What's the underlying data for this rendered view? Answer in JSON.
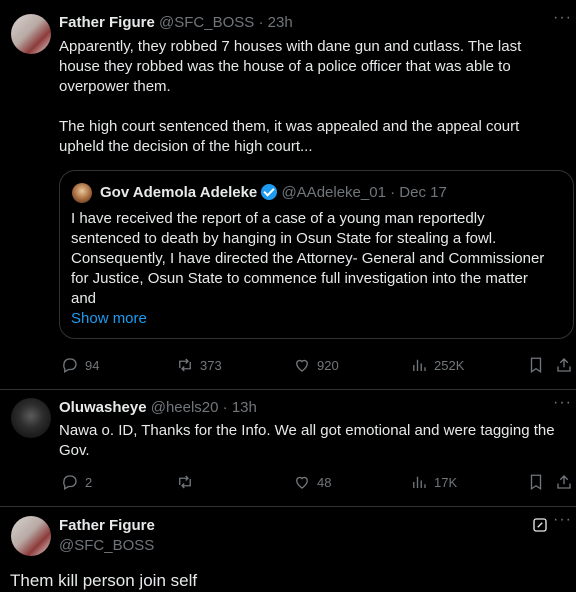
{
  "tweet1": {
    "display_name": "Father Figure",
    "handle": "@SFC_BOSS",
    "separator": "·",
    "time": "23h",
    "lines": [
      "Apparently, they robbed 7 houses with dane gun and cutlass. The last",
      "house they robbed was the house of a police officer that was able to",
      "overpower them.",
      "The high court sentenced them, it was appealed and the appeal court",
      "upheld the decision of the high court..."
    ],
    "quote": {
      "display_name": "Gov Ademola Adeleke",
      "handle": "@AAdeleke_01",
      "separator": "·",
      "date": "Dec 17",
      "lines": [
        "I have received the report of a case of a young man reportedly",
        "sentenced to death by hanging in Osun State for stealing  a fowl.",
        "Consequently, I have directed the Attorney- General and Commissioner",
        "for Justice, Osun State to commence full investigation into the matter",
        "and"
      ],
      "show_more": "Show more"
    },
    "stats": {
      "replies": "94",
      "reposts": "373",
      "likes": "920",
      "views": "252K"
    }
  },
  "tweet2": {
    "display_name": "Oluwasheye",
    "handle": "@heels20",
    "separator": "·",
    "time": "13h",
    "lines": [
      "Nawa o. ID, Thanks  for the Info. We all got emotional and were tagging the",
      "Gov."
    ],
    "stats": {
      "replies": "2",
      "reposts": "",
      "likes": "48",
      "views": "17K"
    }
  },
  "tweet3": {
    "display_name": "Father Figure",
    "handle": "@SFC_BOSS",
    "text": "Them kill person join self"
  },
  "icons": {
    "more": "more-dots-icon",
    "reply": "reply-bubble-icon",
    "repost": "repost-arrows-icon",
    "like": "heart-icon",
    "views": "views-bars-icon",
    "bookmark": "bookmark-icon",
    "share": "share-icon",
    "grok": "grok-icon",
    "verified": "verified-badge-icon"
  },
  "colors": {
    "background": "#000000",
    "text": "#e7e9ea",
    "muted": "#71767b",
    "link": "#1d9bf0",
    "border": "#2f3336"
  }
}
